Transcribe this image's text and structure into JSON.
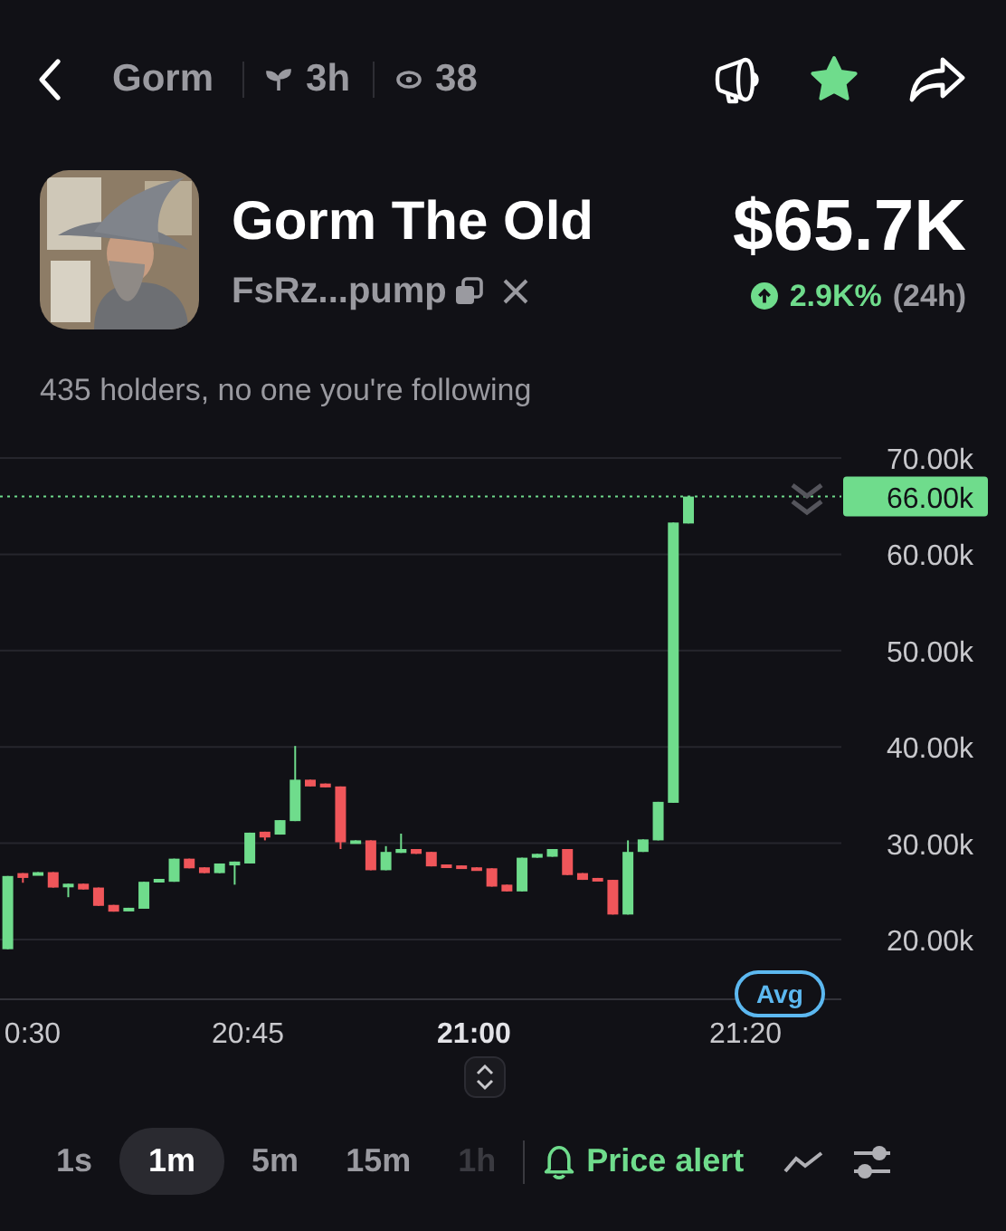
{
  "top_bar": {
    "name": "Gorm",
    "age": "3h",
    "viewers": "38",
    "starred": true
  },
  "token": {
    "name": "Gorm The Old",
    "address": "FsRz...pump",
    "market_cap": "$65.7K",
    "change": "2.9K%",
    "change_period": "(24h)",
    "change_up": true
  },
  "holders_text": "435 holders, no one you're following",
  "chart": {
    "y_labels": [
      "70.00k",
      "60.00k",
      "50.00k",
      "40.00k",
      "30.00k",
      "20.00k"
    ],
    "price_label": "66.00k",
    "x_labels": [
      {
        "text": "0:30",
        "emphasized": false
      },
      {
        "text": "20:45",
        "emphasized": false
      },
      {
        "text": "21:00",
        "emphasized": true
      },
      {
        "text": "21:20",
        "emphasized": false
      }
    ],
    "avg_badge": "Avg"
  },
  "intervals": [
    {
      "label": "1s",
      "selected": false,
      "faded": false
    },
    {
      "label": "1m",
      "selected": true,
      "faded": false
    },
    {
      "label": "5m",
      "selected": false,
      "faded": false
    },
    {
      "label": "15m",
      "selected": false,
      "faded": false
    },
    {
      "label": "1h",
      "selected": false,
      "faded": true
    }
  ],
  "price_alert": "Price alert"
}
